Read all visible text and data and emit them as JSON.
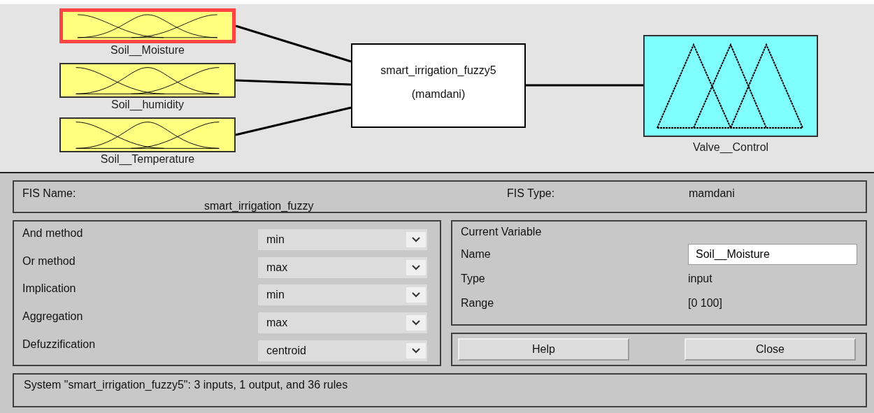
{
  "inputs": [
    {
      "name": "Soil__Moisture",
      "selected": true
    },
    {
      "name": "Soil__humidity",
      "selected": false
    },
    {
      "name": "Soil__Temperature",
      "selected": false
    }
  ],
  "system": {
    "name": "smart_irrigation_fuzzy5",
    "type": "(mamdani)"
  },
  "outputs": [
    {
      "name": "Valve__Control",
      "selected": false
    }
  ],
  "fis_name": {
    "label": "FIS Name:",
    "value": "smart_irrigation_fuzzy"
  },
  "fis_type": {
    "label": "FIS Type:",
    "value": "mamdani"
  },
  "methods": [
    {
      "label": "And method",
      "value": "min"
    },
    {
      "label": "Or method",
      "value": "max"
    },
    {
      "label": "Implication",
      "value": "min"
    },
    {
      "label": "Aggregation",
      "value": "max"
    },
    {
      "label": "Defuzzification",
      "value": "centroid"
    }
  ],
  "current_variable": {
    "title": "Current Variable",
    "name_label": "Name",
    "name_value": "Soil__Moisture",
    "type_label": "Type",
    "type_value": "input",
    "range_label": "Range",
    "range_value": "[0 100]"
  },
  "buttons": [
    "Help",
    "Close"
  ],
  "status": "System \"smart_irrigation_fuzzy5\": 3 inputs, 1 output, and 36 rules"
}
